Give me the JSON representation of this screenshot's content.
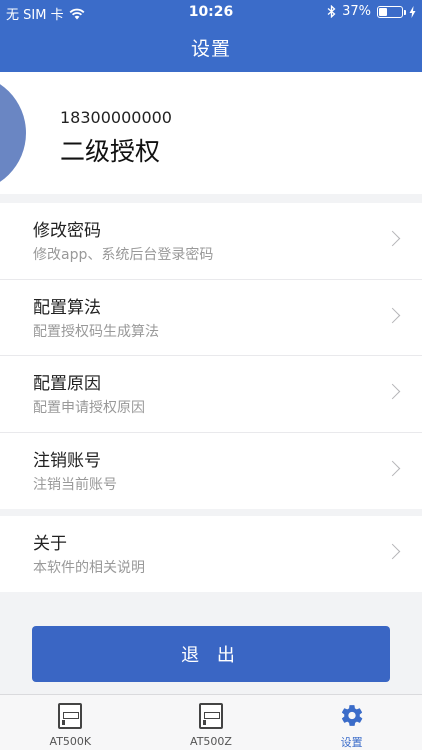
{
  "status_bar": {
    "carrier": "无 SIM 卡",
    "time": "10:26",
    "battery": "37%",
    "battery_level": 0.37
  },
  "header": {
    "title": "设置"
  },
  "profile": {
    "phone": "18300000000",
    "role": "二级授权"
  },
  "settings": [
    {
      "title": "修改密码",
      "subtitle": "修改app、系统后台登录密码"
    },
    {
      "title": "配置算法",
      "subtitle": "配置授权码生成算法"
    },
    {
      "title": "配置原因",
      "subtitle": "配置申请授权原因"
    },
    {
      "title": "注销账号",
      "subtitle": "注销当前账号"
    }
  ],
  "about": {
    "title": "关于",
    "subtitle": "本软件的相关说明"
  },
  "logout_label": "退 出",
  "tabs": [
    {
      "label": "AT500K",
      "icon": "device-icon"
    },
    {
      "label": "AT500Z",
      "icon": "device-icon"
    },
    {
      "label": "设置",
      "icon": "gear-icon"
    }
  ],
  "colors": {
    "primary": "#3b6cc9",
    "avatar": "#6a86c3"
  }
}
